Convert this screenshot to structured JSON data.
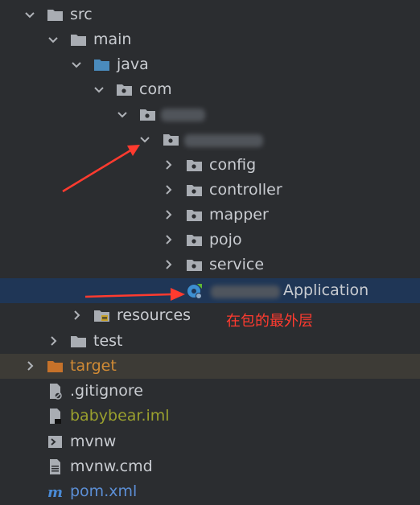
{
  "tree": {
    "src": "src",
    "main": "main",
    "java": "java",
    "com": "com",
    "config": "config",
    "controller": "controller",
    "mapper": "mapper",
    "pojo": "pojo",
    "service": "service",
    "application": "Application",
    "resources": "resources",
    "test": "test",
    "target": "target",
    "gitignore": ".gitignore",
    "iml": "babybear.iml",
    "mvnw": "mvnw",
    "mvnw_cmd": "mvnw.cmd",
    "pom": "pom.xml"
  },
  "annotation": {
    "note": "在包的最外层"
  },
  "colors": {
    "background": "#2b2d30",
    "selected_row": "#1f3656",
    "excluded_row": "#3d3b36",
    "excluded_text": "#d08a35",
    "annotation_red": "#ff3b2f"
  }
}
